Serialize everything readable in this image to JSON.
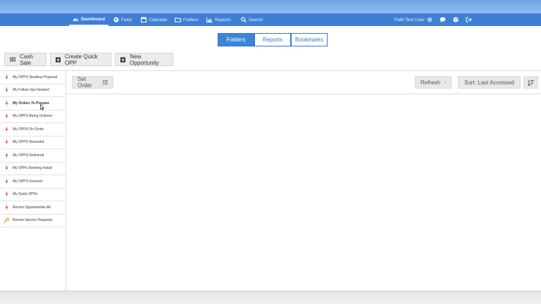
{
  "nav": {
    "items": [
      {
        "label": "Dashboard",
        "icon": "dashboard-icon",
        "active": true
      },
      {
        "label": "Feed",
        "icon": "globe-icon"
      },
      {
        "label": "Calendar",
        "icon": "calendar-icon"
      },
      {
        "label": "Folders",
        "icon": "folder-icon"
      },
      {
        "label": "Reports",
        "icon": "bar-chart-icon"
      },
      {
        "label": "Search",
        "icon": "search-icon"
      }
    ],
    "user": "Path Test User",
    "right_icons": [
      "gear-icon",
      "chat-icon",
      "help-icon",
      "logout-icon"
    ]
  },
  "segmented": {
    "folders": "Folders",
    "reports": "Reports",
    "bookmarks": "Bookmarks",
    "active": "Folders"
  },
  "actions": {
    "cash_sale": "Cash Sale",
    "create_quick_opp": "Create Quick OPP",
    "new_opportunity": "New Opportunity"
  },
  "toolbar": {
    "set_order": "Set Order",
    "refresh": "Refresh",
    "sort": "Sort: Last Accessed"
  },
  "sidebar": {
    "items": [
      {
        "label": "My OPPS Needing Proposal",
        "icon": "bolt-icon"
      },
      {
        "label": "My Follow Ups Needed",
        "icon": "bolt-icon"
      },
      {
        "label": "My Orders To Prepare",
        "icon": "bolt-icon",
        "active": true
      },
      {
        "label": "My OPPS Being Ordered",
        "icon": "bolt-icon"
      },
      {
        "label": "My OPPS On Order",
        "icon": "bolt-icon"
      },
      {
        "label": "My OPPS Received",
        "icon": "bolt-icon"
      },
      {
        "label": "My OPPS Delivered",
        "icon": "bolt-icon"
      },
      {
        "label": "My OPPs Needing Install",
        "icon": "bolt-icon"
      },
      {
        "label": "My OPPS Invoiced",
        "icon": "bolt-icon"
      },
      {
        "label": "My Quick OPPs",
        "icon": "bolt-icon"
      },
      {
        "label": "Recent Opportunities All",
        "icon": "bolt-icon"
      },
      {
        "label": "Recent Service Requests",
        "icon": "wrench-icon"
      }
    ]
  },
  "colors": {
    "nav_bg": "#3f7fd3",
    "accent": "#3a85d6",
    "bolt": "#e0573b",
    "wrench": "#d9a23b"
  }
}
